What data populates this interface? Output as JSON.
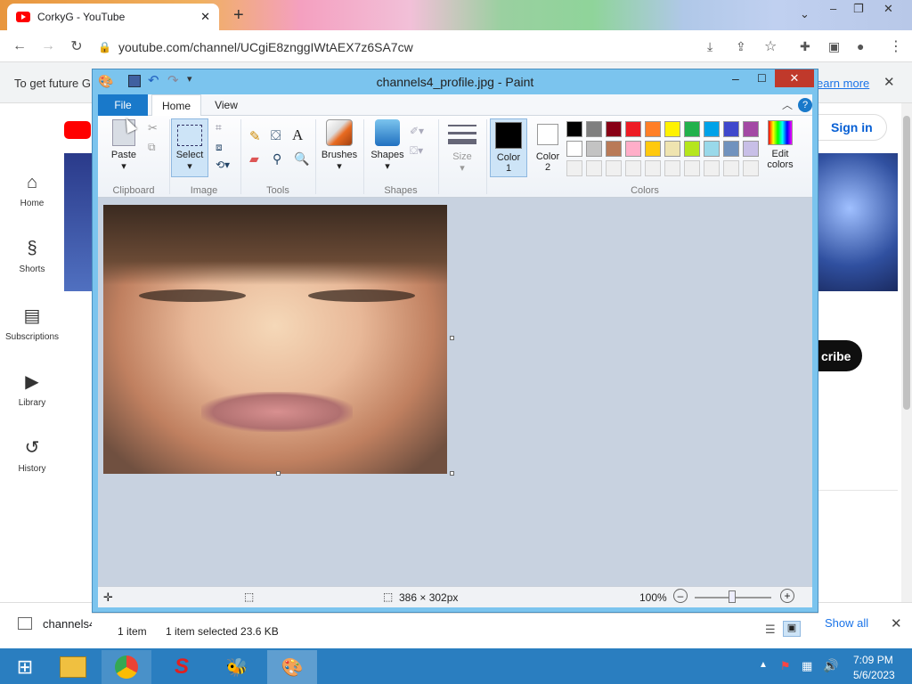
{
  "browser": {
    "tab_title": "CorkyG - YouTube",
    "url": "youtube.com/channel/UCgiE8znggIWtAEX7z6SA7cw",
    "infobar_text": "To get future G",
    "infobar_link": "earn more"
  },
  "youtube": {
    "nav": [
      {
        "label": "Home",
        "icon": "home-icon"
      },
      {
        "label": "Shorts",
        "icon": "shorts-icon"
      },
      {
        "label": "Subscriptions",
        "icon": "subscriptions-icon"
      },
      {
        "label": "Library",
        "icon": "library-icon"
      },
      {
        "label": "History",
        "icon": "history-icon"
      }
    ],
    "signin": "Sign in",
    "subscribe_partial": "cribe"
  },
  "paint": {
    "title": "channels4_profile.jpg - Paint",
    "tabs": {
      "file": "File",
      "home": "Home",
      "view": "View"
    },
    "groups": {
      "clipboard": "Clipboard",
      "image": "Image",
      "tools": "Tools",
      "shapes": "Shapes",
      "colors": "Colors"
    },
    "buttons": {
      "paste": "Paste",
      "select": "Select",
      "brushes": "Brushes",
      "shapes": "Shapes",
      "size": "Size",
      "color1": "Color\n1",
      "color2": "Color\n2",
      "edit_colors": "Edit\ncolors"
    },
    "palette_row1": [
      "#000000",
      "#7f7f7f",
      "#880015",
      "#ed1c24",
      "#ff7f27",
      "#fff200",
      "#22b14c",
      "#00a2e8",
      "#3f48cc",
      "#a349a4"
    ],
    "palette_row2": [
      "#ffffff",
      "#c3c3c3",
      "#b97a57",
      "#ffaec9",
      "#ffc90e",
      "#efe4b0",
      "#b5e61d",
      "#99d9ea",
      "#7092be",
      "#c8bfe7"
    ],
    "color1": "#000000",
    "color2": "#ffffff",
    "image_size": "386 × 302px",
    "zoom": "100%"
  },
  "explorer": {
    "item_count": "1 item",
    "selected": "1 item selected  23.6 KB"
  },
  "downloads": {
    "file": "channels4_",
    "show_all": "Show all"
  },
  "taskbar": {
    "time": "7:09 PM",
    "date": "5/6/2023"
  }
}
